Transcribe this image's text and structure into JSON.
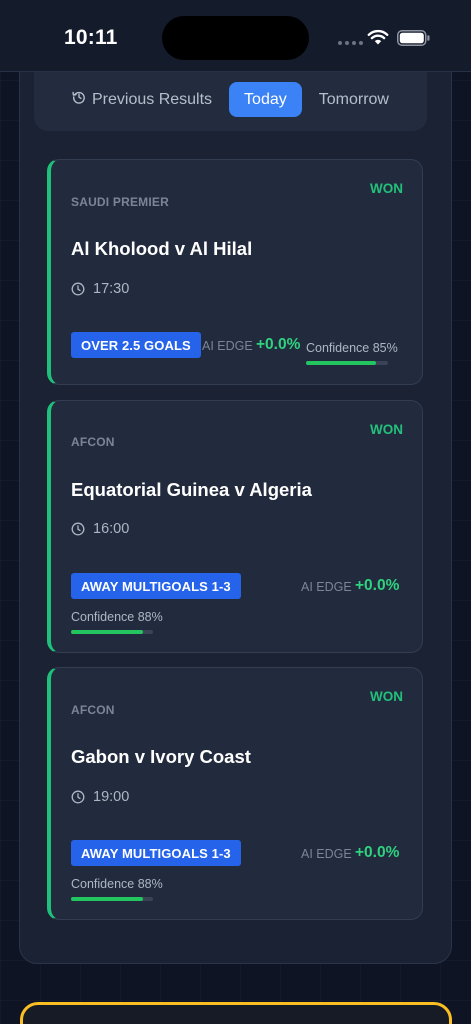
{
  "status_bar": {
    "time": "10:11"
  },
  "tabs": [
    {
      "label": "Previous Results",
      "icon": "history-icon",
      "active": false
    },
    {
      "label": "Today",
      "active": true
    },
    {
      "label": "Tomorrow",
      "active": false
    }
  ],
  "colors": {
    "accent": "#3b82f6",
    "won": "#22c07a",
    "tip_badge": "#2563eb",
    "highlight_border": "#fbbf24"
  },
  "predictions": [
    {
      "league": "SAUDI PREMIER",
      "status": "WON",
      "match": "Al Kholood v Al Hilal",
      "time": "17:30",
      "tip": "OVER 2.5 GOALS",
      "ai_edge_label": "AI EDGE",
      "ai_edge": "+0.0%",
      "confidence_label": "Confidence 85%",
      "confidence": 0.85
    },
    {
      "league": "AFCON",
      "status": "WON",
      "match": "Equatorial Guinea v Algeria",
      "time": "16:00",
      "tip": "AWAY MULTIGOALS 1-3",
      "ai_edge_label": "AI EDGE",
      "ai_edge": "+0.0%",
      "confidence_label": "Confidence 88%",
      "confidence": 0.88
    },
    {
      "league": "AFCON",
      "status": "WON",
      "match": "Gabon v Ivory Coast",
      "time": "19:00",
      "tip": "AWAY MULTIGOALS 1-3",
      "ai_edge_label": "AI EDGE",
      "ai_edge": "+0.0%",
      "confidence_label": "Confidence 88%",
      "confidence": 0.88
    }
  ]
}
